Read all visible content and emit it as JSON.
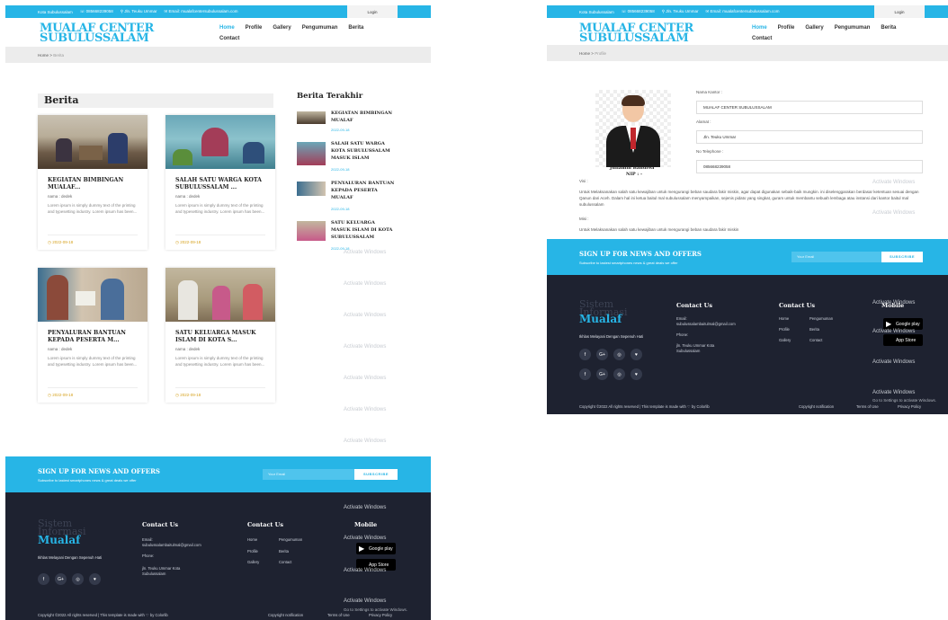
{
  "topbar": {
    "location": "Kota Subulussalam",
    "phone": "085668239058",
    "address": "Jln. Teuku Ummar",
    "email": "Email: mualafcentersubulussalam.com",
    "login": "Login"
  },
  "logo": {
    "line1": "MUALAF CENTER",
    "line2": "SUBULUSSALAM"
  },
  "nav": {
    "home": "Home",
    "profile": "Profile",
    "gallery": "Gallery",
    "pengumuman": "Pengumuman",
    "berita": "Berita",
    "contact": "Contact"
  },
  "left": {
    "breadcrumb": {
      "home": "Home",
      "sep": ">",
      "current": "Berita"
    },
    "section_title": "Berita",
    "cards": [
      {
        "title": "KEGIATAN BIMBINGAN MUALAF...",
        "author": "nama : dedek",
        "excerpt": "Lorem ipsum is simply dummy text of the printing and typesetting industry. Lorem ipsum has been...",
        "date": "2022-09-18"
      },
      {
        "title": "SALAH SATU WARGA KOTA SUBULUSSALAM ...",
        "author": "nama : dedek",
        "excerpt": "Lorem ipsum is simply dummy text of the printing and typesetting industry. Lorem ipsum has been...",
        "date": "2022-09-18"
      },
      {
        "title": "PENYALURAN BANTUAN KEPADA PESERTA M...",
        "author": "nama : dedek",
        "excerpt": "Lorem ipsum is simply dummy text of the printing and typesetting industry. Lorem ipsum has been...",
        "date": "2022-09-18"
      },
      {
        "title": "SATU KELUARGA MASUK ISLAM DI KOTA S...",
        "author": "nama : dedek",
        "excerpt": "Lorem ipsum is simply dummy text of the printing and typesetting industry. Lorem ipsum has been...",
        "date": "2022-09-18"
      }
    ],
    "sidebar_title": "Berita Terakhir",
    "recent": [
      {
        "title": "KEGIATAN BIMBINGAN MUALAF",
        "date": "2022-09-18"
      },
      {
        "title": "SALAH SATU WARGA KOTA SUBULUSSALAM MASUK ISLAM",
        "date": "2022-09-18"
      },
      {
        "title": "PENYALURAN BANTUAN KEPADA PESERTA MUALAF",
        "date": "2022-09-18"
      },
      {
        "title": "SATU KELUARGA MASUK ISLAM DI KOTA SUBULUSSALAM",
        "date": "2022-09-18"
      }
    ]
  },
  "right": {
    "breadcrumb": {
      "home": "Home",
      "sep": ">",
      "current": "Profile"
    },
    "person_name": "Juliamin Banurea",
    "person_nip": "NIP : -",
    "labels": {
      "kantor": "Nama Kantor :",
      "alamat": "Alamat :",
      "telp": "No Telephone :",
      "visi": "Visi :",
      "misi": "Misi :"
    },
    "values": {
      "kantor": "MUALAF CENTER SUBULUSSALAM",
      "alamat": "Jln. Teuku Ummar",
      "telp": "085668239058"
    },
    "visi": "Untuk Melaksanakan salah satu kewajiban untuk mengurangi beban saudara fakir miskin, agar dapat digunakan sebaik-baik mungkin. ini diselenggarakan berdasar ketentuan sesuai dengan Qanun dari Aceh. Dalam hal ini ketua baitul mal subulussalam menyampaikan, sejenis pidato yang singkat, guram untuk membantu sebuah lembaga atau instansi dari kantor baitul mal subulussalam",
    "misi": "Untuk Melaksanakan salah satu kewajiban untuk mengurangi beban saudara fakir miskin"
  },
  "newsletter": {
    "title": "SIGN UP FOR NEWS AND OFFERS",
    "subtitle": "Subscribe to lastest smartphones news & great deals we offer",
    "placeholder": "Your Email",
    "button": "SUBSCRIBE"
  },
  "footer": {
    "brand1": "Sistem",
    "brand2": "Informasi",
    "brand3": "Mualaf",
    "tagline": "Ikhlas Melayani Dengan Sepenuh Hati",
    "social": [
      "f",
      "G+",
      "◎",
      "♥"
    ],
    "contact_title": "Contact Us",
    "email_label": "Email:",
    "email": "subulussalambaitulmal@gmail.com",
    "phone_label": "Phone:",
    "address": "jln. Teuku Ummar Kota Subulussalam",
    "links_title": "Contact Us",
    "links": [
      "Home",
      "Pengumuman",
      "Profile",
      "Berita",
      "Gallery",
      "Contact"
    ],
    "mobile_title": "Mobile",
    "gplay": "Google play",
    "appstore": "App Store",
    "copyright": "Copyright ©2022 All rights reserved | This template is made with ♡ by Colorlib",
    "copy_links": [
      "Copyright notification",
      "Terms of Use",
      "Privacy Policy"
    ]
  },
  "watermark": {
    "text": "Activate Windows",
    "sub": "Go to Settings to activate Windows."
  }
}
